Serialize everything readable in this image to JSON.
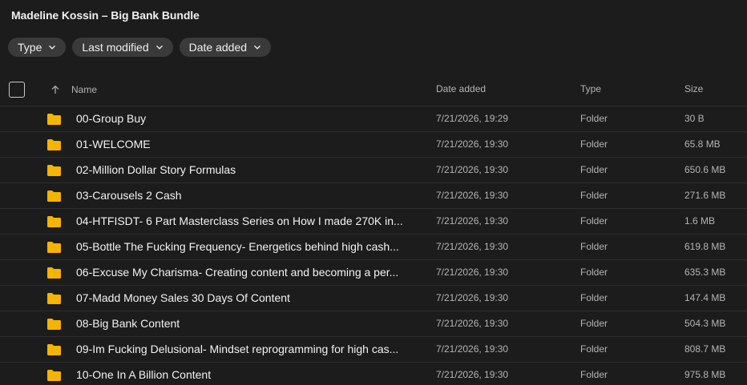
{
  "header": {
    "title": "Madeline Kossin – Big Bank Bundle"
  },
  "filters": [
    {
      "label": "Type",
      "icon": "chevron-down-icon"
    },
    {
      "label": "Last modified",
      "icon": "chevron-down-icon"
    },
    {
      "label": "Date added",
      "icon": "chevron-down-icon"
    }
  ],
  "columns": {
    "name": "Name",
    "date_added": "Date added",
    "type": "Type",
    "size": "Size",
    "sort_icon": "arrow-up-icon"
  },
  "colors": {
    "background": "#1c1c1c",
    "chip": "#3a3a3a",
    "folder": "#f5b400"
  },
  "files": [
    {
      "name": "00-Group Buy",
      "date": "7/21/2026, 19:29",
      "type": "Folder",
      "size": "30 B"
    },
    {
      "name": "01-WELCOME",
      "date": "7/21/2026, 19:30",
      "type": "Folder",
      "size": "65.8 MB"
    },
    {
      "name": "02-Million Dollar Story Formulas",
      "date": "7/21/2026, 19:30",
      "type": "Folder",
      "size": "650.6 MB"
    },
    {
      "name": "03-Carousels 2 Cash",
      "date": "7/21/2026, 19:30",
      "type": "Folder",
      "size": "271.6 MB"
    },
    {
      "name": "04-HTFISDT- 6 Part Masterclass Series on How I made 270K in...",
      "date": "7/21/2026, 19:30",
      "type": "Folder",
      "size": "1.6 MB"
    },
    {
      "name": "05-Bottle The Fucking Frequency- Energetics behind high cash...",
      "date": "7/21/2026, 19:30",
      "type": "Folder",
      "size": "619.8 MB"
    },
    {
      "name": "06-Excuse My Charisma- Creating content and becoming a per...",
      "date": "7/21/2026, 19:30",
      "type": "Folder",
      "size": "635.3 MB"
    },
    {
      "name": "07-Madd Money Sales 30 Days Of Content",
      "date": "7/21/2026, 19:30",
      "type": "Folder",
      "size": "147.4 MB"
    },
    {
      "name": "08-Big Bank Content",
      "date": "7/21/2026, 19:30",
      "type": "Folder",
      "size": "504.3 MB"
    },
    {
      "name": "09-Im Fucking Delusional- Mindset reprogramming for high cas...",
      "date": "7/21/2026, 19:30",
      "type": "Folder",
      "size": "808.7 MB"
    },
    {
      "name": "10-One In A Billion Content",
      "date": "7/21/2026, 19:30",
      "type": "Folder",
      "size": "975.8 MB"
    }
  ]
}
